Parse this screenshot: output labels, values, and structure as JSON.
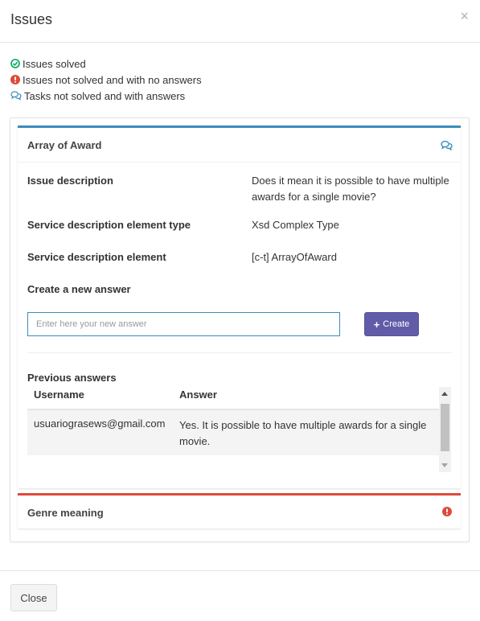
{
  "modal": {
    "title": "Issues",
    "close_glyph": "×"
  },
  "legend": [
    {
      "icon": "check-circle-icon",
      "color": "#00a65a",
      "label": "Issues solved"
    },
    {
      "icon": "exclamation-circle-icon",
      "color": "#dd4b39",
      "label": "Issues not solved and with no answers"
    },
    {
      "icon": "comments-icon",
      "color": "#3c8dbc",
      "label": "Tasks not solved and with answers"
    }
  ],
  "issue_award": {
    "title": "Array of Award",
    "status_icon": "comments-icon",
    "accent": "#3c8dbc",
    "fields": [
      {
        "label": "Issue description",
        "value": "Does it mean it is possible to have multiple awards for a single movie?"
      },
      {
        "label": "Service description element type",
        "value": "Xsd Complex Type"
      },
      {
        "label": "Service description element",
        "value": "[c-t] ArrayOfAward"
      }
    ],
    "new_answer_label": "Create a new answer",
    "new_answer_placeholder": "Enter here your new answer",
    "new_answer_value": "",
    "create_button": {
      "icon": "plus-icon",
      "label": "Create",
      "color": "#605ca8"
    },
    "previous_title": "Previous answers",
    "columns": [
      "Username",
      "Answer"
    ],
    "rows": [
      {
        "username": "usuariograsews@gmail.com",
        "answer": "Yes. It is possible to have multiple awards for a single movie."
      }
    ]
  },
  "issue_genre": {
    "title": "Genre meaning",
    "status_icon": "exclamation-circle-icon",
    "accent": "#dd4b39"
  },
  "footer": {
    "close_label": "Close"
  }
}
